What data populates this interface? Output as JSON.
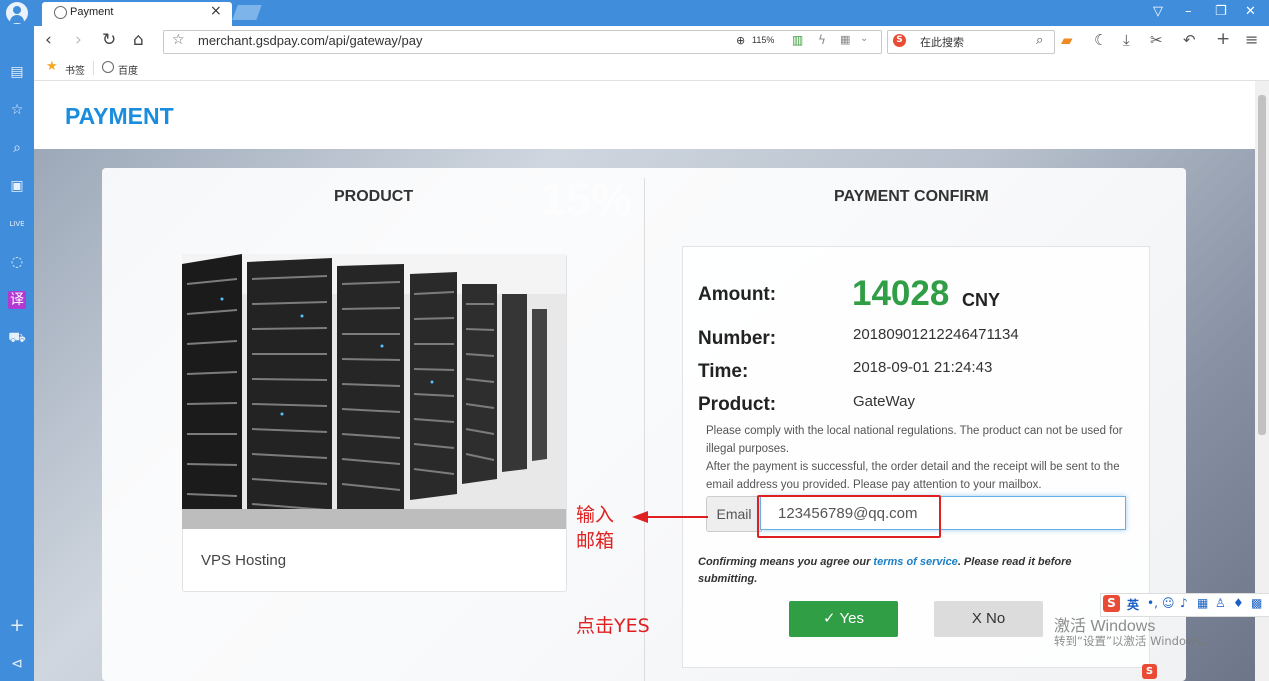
{
  "browser": {
    "tab_title": "Payment",
    "tab_close": "×",
    "url": "merchant.gsdpay.com/api/gateway/pay",
    "zoom": "115%",
    "search_placeholder": "在此搜索",
    "bookmarks": [
      {
        "label": "书签",
        "icon": "star-icon"
      },
      {
        "label": "百度",
        "icon": "globe-icon"
      }
    ]
  },
  "page": {
    "header_title": "PAYMENT",
    "product_heading": "PRODUCT",
    "confirm_heading": "PAYMENT CONFIRM",
    "product_name": "VPS Hosting",
    "amount_label": "Amount:",
    "amount_value": "14028",
    "amount_currency": "CNY",
    "number_label": "Number:",
    "number_value": "20180901212246471134",
    "time_label": "Time:",
    "time_value": "2018-09-01 21:24:43",
    "product_label": "Product:",
    "product_value": "GateWay",
    "notice_1": "Please comply with the local national regulations. The product can not be used for illegal purposes.",
    "notice_2": "After the payment is successful, the order detail and the receipt will be sent to the email address you provided. Please pay attention to your mailbox.",
    "email_label": "Email",
    "email_value": "123456789@qq.com",
    "terms_prefix": "Confirming means you agree our ",
    "terms_link": "terms of service",
    "terms_suffix": ". Please read it before submitting.",
    "yes_label": "✓ Yes",
    "no_label": "X No",
    "watermark": "15%"
  },
  "annotations": {
    "enter_email_line1": "输入",
    "enter_email_line2": "邮箱",
    "click_yes": "点击YES"
  },
  "windows_activation": {
    "line1": "激活 Windows",
    "line2": "转到“设置”以激活 Windows。"
  },
  "ime": {
    "mode": "英"
  },
  "colors": {
    "accent_blue": "#3f8ddb",
    "header_blue": "#1a8ddf",
    "amount_green": "#2f9e44",
    "annotation_red": "#e02020"
  }
}
